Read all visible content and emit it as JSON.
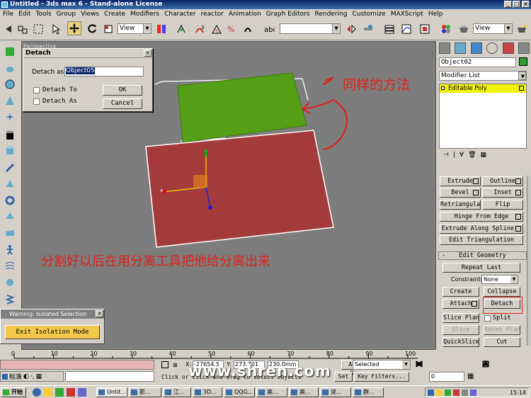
{
  "window": {
    "title": "Untitled - 3ds max 6 - Stand-alone License",
    "min": "_",
    "max": "□",
    "close": "×"
  },
  "menu": [
    "File",
    "Edit",
    "Tools",
    "Group",
    "Views",
    "Create",
    "Modifiers",
    "Character",
    "reactor",
    "Animation",
    "Graph Editors",
    "Rendering",
    "Customize",
    "MAXScript",
    "Help"
  ],
  "toolbar": {
    "view_select": "View",
    "view_select2": "View",
    "selection_set": ""
  },
  "viewport": {
    "label": "Perspective",
    "annotation_top": "同样的方法",
    "annotation_bottom": "分割好以后在用分离工具把他给分离出来"
  },
  "detach_dialog": {
    "title": "Detach",
    "label": "Detach as:",
    "value": "Object05",
    "detach_to": "Detach To",
    "detach_as": "Detach As",
    "ok": "OK",
    "cancel": "Cancel"
  },
  "isolation": {
    "title": "Warning: Isolated Selection",
    "button": "Exit Isolation Mode"
  },
  "command_panel": {
    "object_name": "Object02",
    "modifier_list": "Modifier List",
    "stack_item": "Editable Poly",
    "buttons": {
      "extrude": "Extrude",
      "outline": "Outline",
      "bevel": "Bevel",
      "inset": "Inset",
      "retriangulate": "Retriangulate",
      "flip": "Flip",
      "hinge": "Hinge From Edge",
      "extrude_spline": "Extrude Along Spline",
      "edit_tri": "Edit Triangulation",
      "rollout": "Edit Geometry",
      "repeat_last": "Repeat Last",
      "constraints_label": "Constraints:",
      "constraints_value": "None",
      "create": "Create",
      "collapse": "Collapse",
      "attach": "Attach",
      "detach": "Detach",
      "slice_plane": "Slice Plane",
      "split": "Split",
      "slice": "Slice",
      "reset_plane": "Reset Plane",
      "quickslice": "QuickSlice",
      "cut": "Cut"
    }
  },
  "trackbar": {
    "ticks": [
      "0",
      "10",
      "20",
      "30",
      "40",
      "50",
      "60",
      "70",
      "80",
      "90",
      "100"
    ]
  },
  "status": {
    "x_label": "X:",
    "x_value": "-27654.5",
    "y_label": "Y:",
    "y_value": "273.701",
    "z_value": "230.0mm",
    "prompt": "Click or click-and-drag to select objects",
    "auto_key": "Auto Key",
    "set_key": "Set Key",
    "selected": "Selected",
    "key_filters": "Key Filters...",
    "frame": "0",
    "cn_label": "标准"
  },
  "watermark": "www.shren.com",
  "taskbar": {
    "start": "开始",
    "tasks": [
      "Untit...",
      "影...",
      "江...",
      "3D...",
      "QQG...",
      "高...",
      "高...",
      "说...",
      "群..."
    ],
    "clock": "15:14"
  },
  "colors": {
    "green_plane": "#559f17",
    "red_plane": "#a33b3b",
    "annotation": "#e0201c",
    "stack_highlight": "#f2f200"
  }
}
